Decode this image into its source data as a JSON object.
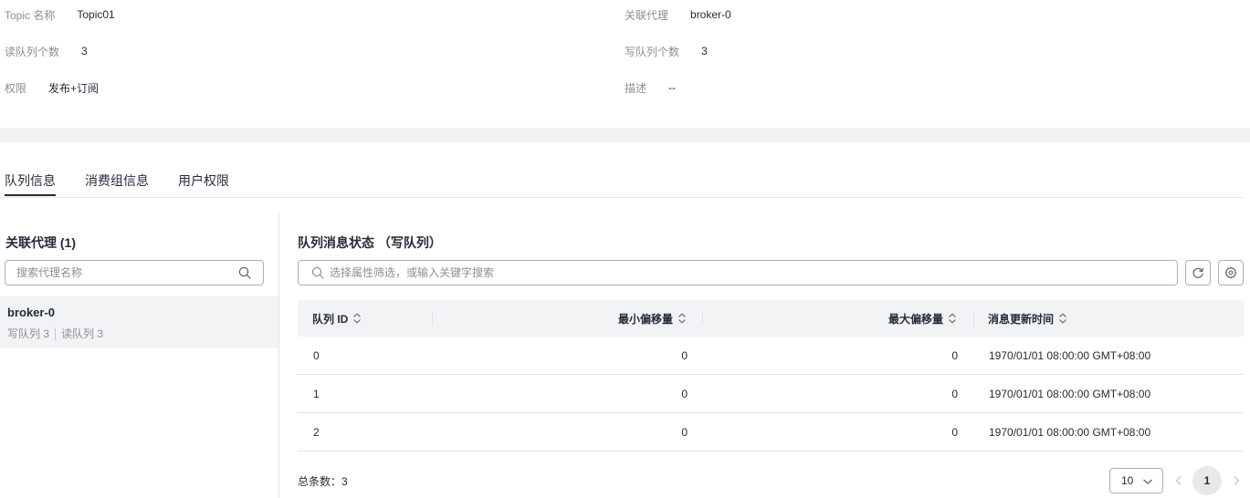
{
  "details": {
    "topic_name_label": "Topic 名称",
    "topic_name_value": "Topic01",
    "broker_label": "关联代理",
    "broker_value": "broker-0",
    "read_queues_label": "读队列个数",
    "read_queues_value": "3",
    "write_queues_label": "写队列个数",
    "write_queues_value": "3",
    "permission_label": "权限",
    "permission_value": "发布+订阅",
    "description_label": "描述",
    "description_value": "--"
  },
  "tabs": [
    {
      "label": "队列信息",
      "active": true
    },
    {
      "label": "消费组信息",
      "active": false
    },
    {
      "label": "用户权限",
      "active": false
    }
  ],
  "left_panel": {
    "title": "关联代理 (1)",
    "search_placeholder": "搜索代理名称",
    "brokers": [
      {
        "name": "broker-0",
        "write_queues": "写队列 3",
        "read_queues": "读队列 3"
      }
    ]
  },
  "right_panel": {
    "title": "队列消息状态 （写队列）",
    "filter_placeholder": "选择属性筛选，或输入关键字搜索",
    "columns": [
      "队列 ID",
      "最小偏移量",
      "最大偏移量",
      "消息更新时间"
    ],
    "rows": [
      [
        "0",
        "0",
        "0",
        "1970/01/01 08:00:00 GMT+08:00"
      ],
      [
        "1",
        "0",
        "0",
        "1970/01/01 08:00:00 GMT+08:00"
      ],
      [
        "2",
        "0",
        "0",
        "1970/01/01 08:00:00 GMT+08:00"
      ]
    ]
  },
  "pagination": {
    "total_label": "总条数：3",
    "page_size": "10",
    "current_page": "1"
  },
  "icons": {
    "search": "search-icon",
    "refresh": "refresh-icon",
    "settings": "gear-icon",
    "sort": "sort-icon",
    "chevron_down": "chevron-down-icon",
    "chevron_left": "chevron-left-icon",
    "chevron_right": "chevron-right-icon"
  },
  "colors": {
    "text": "#252b3a",
    "muted": "#8a8e99",
    "border": "#adb0b8",
    "band": "#f2f2f2",
    "header_bg": "#f2f3f5"
  }
}
